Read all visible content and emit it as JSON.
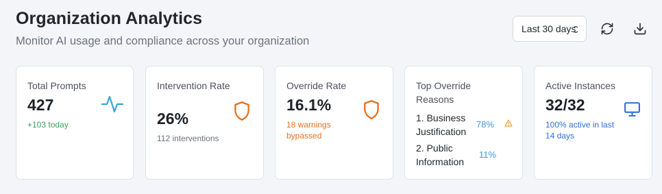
{
  "header": {
    "title": "Organization Analytics",
    "subtitle": "Monitor AI usage and compliance across your organization",
    "range_value": "Last 30 days",
    "refresh_icon": "refresh-icon",
    "download_icon": "download-icon"
  },
  "cards": {
    "total_prompts": {
      "label": "Total Prompts",
      "value": "427",
      "note": "+103 today",
      "icon": "activity-icon"
    },
    "intervention_rate": {
      "label": "Intervention Rate",
      "value": "26%",
      "note": "112 interventions",
      "icon": "shield-icon"
    },
    "override_rate": {
      "label": "Override Rate",
      "value": "16.1%",
      "note": "18 warnings bypassed",
      "icon": "shield-icon"
    },
    "top_override_reasons": {
      "label": "Top Override Reasons",
      "items": [
        {
          "label": "1. Business Justification",
          "pct": "78%",
          "icon": "warning-icon"
        },
        {
          "label": "2. Public Information",
          "pct": "11%"
        }
      ]
    },
    "active_instances": {
      "label": "Active Instances",
      "value": "32/32",
      "note": "100% active in last 14 days",
      "icon": "monitor-icon"
    }
  },
  "colors": {
    "green": "#3aa25a",
    "orange": "#e8711a",
    "blue": "#2f6fe0",
    "teal": "#3aa3d8",
    "amber": "#f0a030"
  }
}
